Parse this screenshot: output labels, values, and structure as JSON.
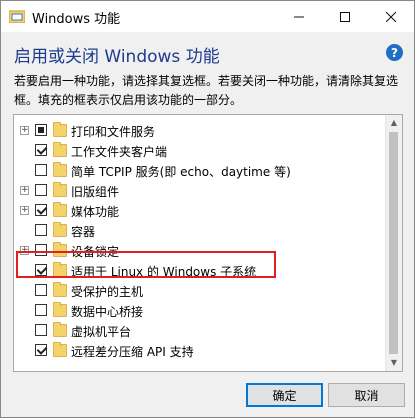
{
  "window": {
    "title": "Windows 功能",
    "app_icon": "windows-features-icon"
  },
  "header": {
    "heading": "启用或关闭 Windows 功能",
    "description": "若要启用一种功能，请选择其复选框。若要关闭一种功能，请清除其复选框。填充的框表示仅启用该功能的一部分。"
  },
  "features": [
    {
      "label": "打印和文件服务",
      "expandable": true,
      "state": "partial"
    },
    {
      "label": "工作文件夹客户端",
      "expandable": false,
      "state": "checked"
    },
    {
      "label": "简单 TCPIP 服务(即 echo、daytime 等)",
      "expandable": false,
      "state": "unchecked"
    },
    {
      "label": "旧版组件",
      "expandable": true,
      "state": "unchecked"
    },
    {
      "label": "媒体功能",
      "expandable": true,
      "state": "checked"
    },
    {
      "label": "容器",
      "expandable": false,
      "state": "unchecked"
    },
    {
      "label": "设备锁定",
      "expandable": true,
      "state": "unchecked"
    },
    {
      "label": "适用于 Linux 的 Windows 子系统",
      "expandable": false,
      "state": "checked",
      "highlighted": true
    },
    {
      "label": "受保护的主机",
      "expandable": false,
      "state": "unchecked"
    },
    {
      "label": "数据中心桥接",
      "expandable": false,
      "state": "unchecked"
    },
    {
      "label": "虚拟机平台",
      "expandable": false,
      "state": "unchecked"
    },
    {
      "label": "远程差分压缩 API 支持",
      "expandable": false,
      "state": "checked"
    }
  ],
  "buttons": {
    "ok": "确定",
    "cancel": "取消"
  },
  "colors": {
    "heading": "#1e3c8c",
    "help": "#1f6fc6",
    "highlight": "#e02020",
    "folder": "#f4d36b"
  }
}
